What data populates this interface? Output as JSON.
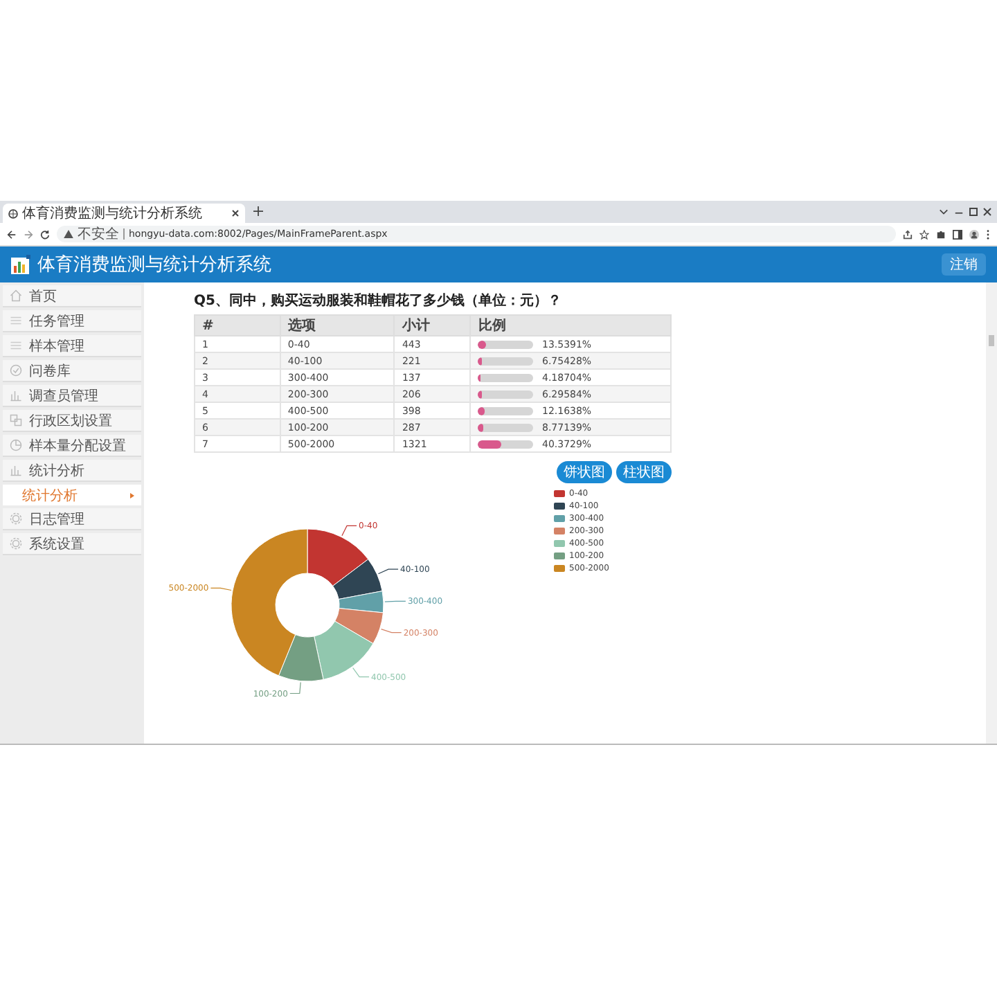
{
  "browser": {
    "tab": {
      "title": "体育消费监测与统计分析系统",
      "selected": true
    },
    "security": "不安全",
    "url": "hongyu-data.com:8002/Pages/MainFrameParent.aspx"
  },
  "header": {
    "title": "体育消费监测与统计分析系统",
    "logout": "注销"
  },
  "sidebar": {
    "items": [
      {
        "label": "首页"
      },
      {
        "label": "任务管理"
      },
      {
        "label": "样本管理"
      },
      {
        "label": "问卷库"
      },
      {
        "label": "调查员管理"
      },
      {
        "label": "行政区划设置"
      },
      {
        "label": "样本量分配设置"
      },
      {
        "label": "统计分析",
        "children": [
          {
            "label": "统计分析",
            "selected": true
          }
        ]
      },
      {
        "label": "日志管理"
      },
      {
        "label": "系统设置"
      }
    ]
  },
  "question": "Q5、同中，购买运动服装和鞋帽花了多少钱（单位：元）？",
  "table": {
    "columns": [
      "#",
      "选项",
      "小计",
      "比例"
    ],
    "rows": [
      {
        "index": "1",
        "option": "0-40",
        "count": "443",
        "level": 0.135391,
        "percent": "13.5391%"
      },
      {
        "index": "2",
        "option": "40-100",
        "count": "221",
        "level": 0.0675428,
        "percent": "6.75428%"
      },
      {
        "index": "3",
        "option": "300-400",
        "count": "137",
        "level": 0.0418704,
        "percent": "4.18704%"
      },
      {
        "index": "4",
        "option": "200-300",
        "count": "206",
        "level": 0.0629584,
        "percent": "6.29584%"
      },
      {
        "index": "5",
        "option": "400-500",
        "count": "398",
        "level": 0.121638,
        "percent": "12.1638%"
      },
      {
        "index": "6",
        "option": "100-200",
        "count": "287",
        "level": 0.0877139,
        "percent": "8.77139%"
      },
      {
        "index": "7",
        "option": "500-2000",
        "count": "1321",
        "level": 0.403729,
        "percent": "40.3729%"
      }
    ]
  },
  "chart_buttons": [
    "饼状图",
    "柱状图"
  ],
  "legend": [
    {
      "label": "0-40",
      "color": "#c23531"
    },
    {
      "label": "40-100",
      "color": "#2f4554"
    },
    {
      "label": "300-400",
      "color": "#61a0a8"
    },
    {
      "label": "200-300",
      "color": "#d48265"
    },
    {
      "label": "400-500",
      "color": "#91c7ae"
    },
    {
      "label": "100-200",
      "color": "#749f83"
    },
    {
      "label": "500-2000",
      "color": "#ca8622"
    }
  ],
  "chart_data": {
    "type": "donut",
    "categories": [
      "0-40",
      "40-100",
      "300-400",
      "200-300",
      "400-500",
      "100-200",
      "500-2000"
    ],
    "data_labels": true
  }
}
